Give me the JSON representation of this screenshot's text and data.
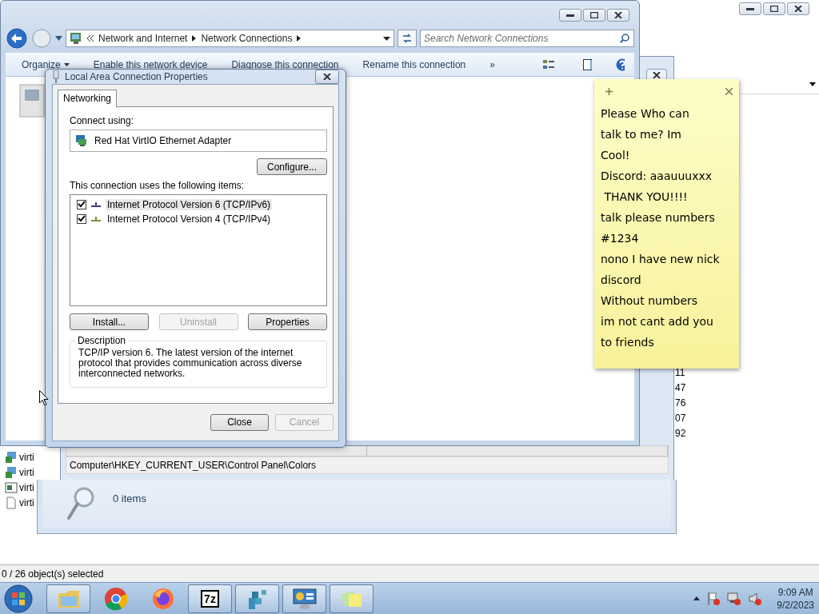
{
  "back_window": {
    "items": [
      {
        "label": "virti",
        "kind": "package"
      },
      {
        "label": "virti",
        "kind": "package"
      },
      {
        "label": "virti",
        "kind": "window"
      },
      {
        "label": "virti",
        "kind": "document"
      }
    ],
    "column_values": [
      "11",
      "47",
      "76",
      "07",
      "92"
    ],
    "status": "0 / 26 object(s) selected"
  },
  "registry_window": {
    "status_path": "Computer\\HKEY_CURRENT_USER\\Control Panel\\Colors"
  },
  "search_window": {
    "status": "0 items"
  },
  "explorer": {
    "breadcrumb": [
      "Network and Internet",
      "Network Connections"
    ],
    "search": {
      "placeholder": "Search Network Connections"
    },
    "commands": [
      {
        "label": "Organize",
        "dropdown": true
      },
      {
        "label": "Enable this network device",
        "dropdown": false
      },
      {
        "label": "Diagnose this connection",
        "dropdown": false
      },
      {
        "label": "Rename this connection",
        "dropdown": false
      }
    ],
    "overflow": "»"
  },
  "dialog": {
    "title": "Local Area Connection Properties",
    "tabs": [
      {
        "label": "Networking",
        "selected": true
      }
    ],
    "connect_using_label": "Connect using:",
    "adapter": "Red Hat VirtIO Ethernet Adapter",
    "configure": "Configure...",
    "items_label": "This connection uses the following items:",
    "items": [
      {
        "label": "Internet Protocol Version 6 (TCP/IPv6)",
        "checked": true,
        "selected": true,
        "color": "#404080"
      },
      {
        "label": "Internet Protocol Version 4 (TCP/IPv4)",
        "checked": true,
        "selected": false,
        "color": "#8a8a3a"
      }
    ],
    "buttons": [
      {
        "label": "Install...",
        "disabled": false
      },
      {
        "label": "Uninstall",
        "disabled": true
      },
      {
        "label": "Properties",
        "disabled": false
      }
    ],
    "description_label": "Description",
    "description": "TCP/IP version 6. The latest version of the internet protocol that provides communication across diverse interconnected networks.",
    "footer_buttons": [
      {
        "label": "Close",
        "disabled": false
      },
      {
        "label": "Cancel",
        "disabled": true
      }
    ]
  },
  "sticky_note": {
    "lines": [
      "Please Who can",
      "talk to me? Im",
      "Cool!",
      "Discord: aaauuuxxx",
      " THANK YOU!!!!",
      "talk please numbers",
      "#1234",
      "nono I have new nick",
      "discord",
      "Without numbers",
      "im not cant add you",
      "to friends"
    ]
  },
  "taskbar": {
    "apps": [
      {
        "kind": "explorer",
        "running": true
      },
      {
        "kind": "chrome",
        "running": false
      },
      {
        "kind": "firefox",
        "running": false
      },
      {
        "kind": "sevenzip",
        "running": true,
        "label": "7z"
      },
      {
        "kind": "registry",
        "running": true
      },
      {
        "kind": "control-panel",
        "running": true
      },
      {
        "kind": "sticky-notes",
        "running": true
      }
    ],
    "clock": {
      "time": "9:09 AM",
      "date": "9/2/2023"
    }
  }
}
